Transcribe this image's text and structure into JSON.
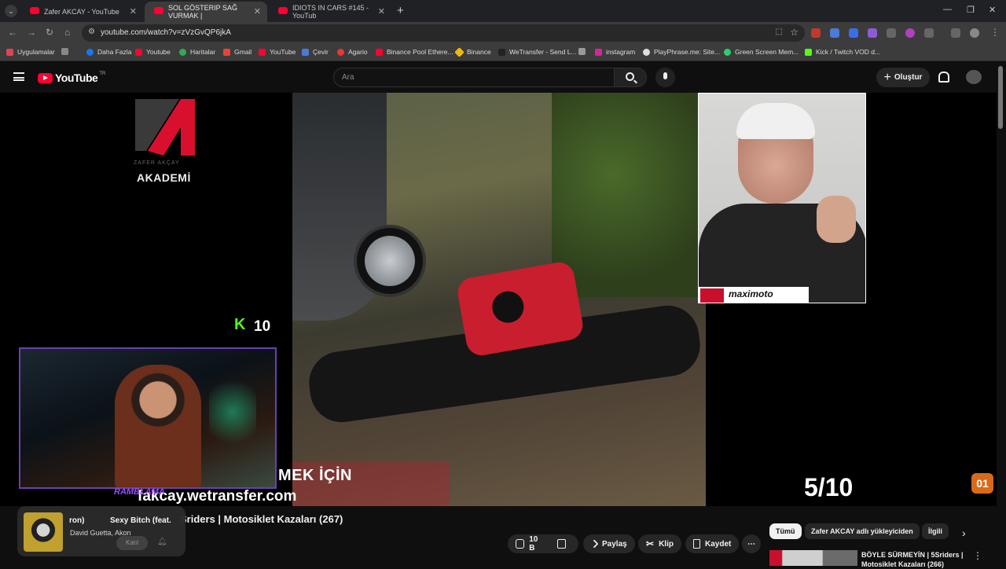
{
  "browser": {
    "tabs": [
      {
        "title": "Zafer AKCAY - YouTube",
        "active": false
      },
      {
        "title": "SOL GÖSTERIP SAĞ VURMAK |",
        "active": true
      },
      {
        "title": "IDIOTS IN CARS #145 - YouTub",
        "active": false
      }
    ],
    "url": "youtube.com/watch?v=zVzGvQP6jkA",
    "bookmarks": [
      "Uygulamalar",
      "Daha Fazla",
      "Youtube",
      "Haritalar",
      "Gmail",
      "YouTube",
      "Çevir",
      "Agario",
      "Binance Pool Ethere...",
      "Binance",
      "WeTransfer - Send L...",
      "instagram",
      "PlayPhrase.me: Site...",
      "Green Screen Mem...",
      "Kick / Twitch VOD d..."
    ]
  },
  "youtube": {
    "logo_text": "YouTube",
    "region": "TR",
    "search_placeholder": "Ara",
    "create_label": "Oluştur"
  },
  "video": {
    "channel_brand": "ZAFER AKÇAY",
    "channel_academy": "AKADEMİ",
    "kick_icon": "K",
    "kick_count": "10",
    "lower_third_top": "MEK İÇİN",
    "lower_third_link": "fakcay.wetransfer.com",
    "sponsor": "maximoto",
    "score": "5/10",
    "subscribe_badge": "01",
    "streamer_banner": "RAMBLAMA"
  },
  "below": {
    "title": "Sriders | Motosiklet Kazaları (267)",
    "now_playing": {
      "artist_prefix": "ron)",
      "track": "Sexy Bitch (feat.",
      "artists": "David Guetta, Akon",
      "join": "Katıl"
    },
    "actions": {
      "likes": "10 B",
      "share": "Paylaş",
      "clip": "Klip",
      "save": "Kaydet"
    },
    "chips": [
      "Tümü",
      "Zafer AKCAY adlı yükleyiciden",
      "İlgili"
    ],
    "rec_title": "BÖYLE SÜRMEYİN | 5Sriders | Motosiklet Kazaları (266)"
  }
}
